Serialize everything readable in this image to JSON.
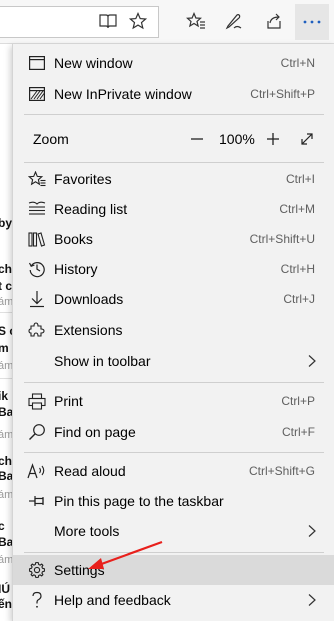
{
  "menu": {
    "new_window": {
      "label": "New window",
      "shortcut": "Ctrl+N",
      "icon": "window-icon"
    },
    "new_inprivate": {
      "label": "New InPrivate window",
      "shortcut": "Ctrl+Shift+P",
      "icon": "inprivate-icon"
    },
    "zoom": {
      "label": "Zoom",
      "value": "100%"
    },
    "favorites": {
      "label": "Favorites",
      "shortcut": "Ctrl+I",
      "icon": "favorites-icon"
    },
    "reading_list": {
      "label": "Reading list",
      "shortcut": "Ctrl+M",
      "icon": "reading-list-icon"
    },
    "books": {
      "label": "Books",
      "shortcut": "Ctrl+Shift+U",
      "icon": "books-icon"
    },
    "history": {
      "label": "History",
      "shortcut": "Ctrl+H",
      "icon": "history-icon"
    },
    "downloads": {
      "label": "Downloads",
      "shortcut": "Ctrl+J",
      "icon": "download-icon"
    },
    "extensions": {
      "label": "Extensions",
      "icon": "extensions-icon"
    },
    "show_in_toolbar": {
      "label": "Show in toolbar"
    },
    "print": {
      "label": "Print",
      "shortcut": "Ctrl+P",
      "icon": "print-icon"
    },
    "find_on_page": {
      "label": "Find on page",
      "shortcut": "Ctrl+F",
      "icon": "search-icon"
    },
    "read_aloud": {
      "label": "Read aloud",
      "shortcut": "Ctrl+Shift+G",
      "icon": "read-aloud-icon"
    },
    "pin_taskbar": {
      "label": "Pin this page to the taskbar",
      "icon": "pin-icon"
    },
    "more_tools": {
      "label": "More tools"
    },
    "settings": {
      "label": "Settings",
      "icon": "gear-icon"
    },
    "help": {
      "label": "Help and feedback",
      "icon": "help-icon"
    }
  },
  "page_fragments": [
    "by",
    "ch",
    "t c",
    "ám",
    "S c",
    "m",
    "ám",
    "ik",
    "Ba",
    "ám",
    "ch",
    "Ba",
    "ám",
    "c",
    "Ba",
    "ám",
    "IÚ",
    "ến"
  ],
  "colors": {
    "annotation_arrow": "#e8201c",
    "menu_bg": "#f2f2f2",
    "highlight": "#dadada"
  }
}
